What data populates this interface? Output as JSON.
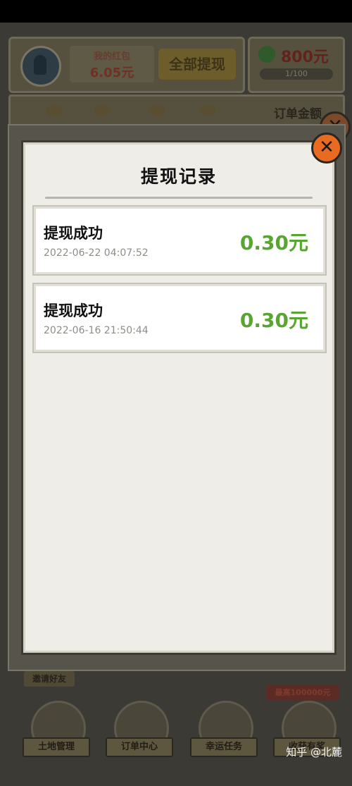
{
  "hud": {
    "redpack_title": "我的红包",
    "redpack_amount": "6.05元",
    "withdraw_all_label": "全部提现",
    "cash_amount": "800元",
    "cash_progress": "1/100",
    "order_amount_label": "订单金额"
  },
  "bottom": {
    "invite_label": "邀请好友",
    "prize_label": "最高100000元",
    "nav": [
      {
        "label": "土地管理"
      },
      {
        "label": "订单中心"
      },
      {
        "label": "幸运任务"
      },
      {
        "label": "收获有奖"
      }
    ]
  },
  "modal": {
    "title": "提现记录",
    "records": [
      {
        "status": "提现成功",
        "time": "2022-06-22 04:07:52",
        "amount": "0.30元"
      },
      {
        "status": "提现成功",
        "time": "2022-06-16 21:50:44",
        "amount": "0.30元"
      }
    ],
    "close_symbol": "✕"
  },
  "watermark": "知乎 @北麓",
  "colors": {
    "amount_green": "#58a531",
    "close_orange": "#e96a21",
    "panel_bg": "#efede7"
  }
}
